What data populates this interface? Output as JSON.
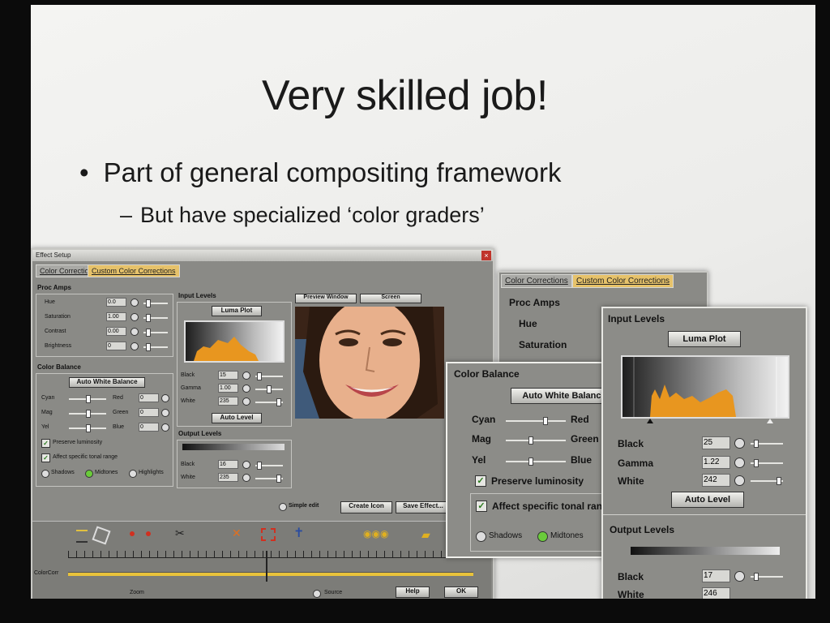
{
  "slide": {
    "title": "Very skilled job!",
    "bullet1": "Part of general compositing framework",
    "bullet2": "But have specialized ‘color graders’"
  },
  "effect_setup": {
    "window_title": "Effect Setup",
    "tabs": [
      "Color Corrections",
      "Custom Color Corrections"
    ],
    "proc_amps": {
      "label": "Proc Amps",
      "rows": [
        {
          "name": "Hue",
          "value": "0.0"
        },
        {
          "name": "Saturation",
          "value": "1.00"
        },
        {
          "name": "Contrast",
          "value": "0.00"
        },
        {
          "name": "Brightness",
          "value": "0"
        }
      ]
    },
    "color_balance": {
      "label": "Color Balance",
      "auto_white_balance": "Auto White Balance",
      "rows": [
        {
          "left": "Cyan",
          "right": "Red",
          "value": "0"
        },
        {
          "left": "Mag",
          "right": "Green",
          "value": "0"
        },
        {
          "left": "Yel",
          "right": "Blue",
          "value": "0"
        }
      ],
      "preserve_luminosity": "Preserve luminosity",
      "affect_tonal": "Affect specific tonal range",
      "tones": [
        "Shadows",
        "Midtones",
        "Highlights"
      ]
    },
    "input_levels": {
      "label": "Input Levels",
      "luma_plot": "Luma Plot",
      "rows": [
        {
          "name": "Black",
          "value": "15"
        },
        {
          "name": "Gamma",
          "value": "1.00"
        },
        {
          "name": "White",
          "value": "235"
        }
      ],
      "auto_level": "Auto Level"
    },
    "output_levels": {
      "label": "Output Levels",
      "rows": [
        {
          "name": "Black",
          "value": "16"
        },
        {
          "name": "White",
          "value": "235"
        }
      ]
    },
    "preview_buttons": [
      "Preview Window",
      "Screen"
    ],
    "simple_edit": "Simple edit",
    "create_icon": "Create Icon",
    "save_effect": "Save Effect...",
    "timeline_label": "ColorCorr",
    "zoom_label": "Zoom",
    "source_label": "Source",
    "help": "Help",
    "ok": "OK"
  },
  "zoom_proc": {
    "tabs": [
      "Color Corrections",
      "Custom Color Corrections"
    ],
    "label": "Proc Amps",
    "rows": [
      "Hue",
      "Saturation"
    ]
  },
  "zoom_balance": {
    "label": "Color Balance",
    "auto_white_balance": "Auto White Balance",
    "rows": [
      {
        "left": "Cyan",
        "right": "Red"
      },
      {
        "left": "Mag",
        "right": "Green"
      },
      {
        "left": "Yel",
        "right": "Blue"
      }
    ],
    "preserve_luminosity": "Preserve luminosity",
    "affect_tonal": "Affect specific tonal range",
    "tones": [
      "Shadows",
      "Midtones"
    ]
  },
  "zoom_levels": {
    "label": "Input Levels",
    "luma_plot": "Luma Plot",
    "rows": [
      {
        "name": "Black",
        "value": "25"
      },
      {
        "name": "Gamma",
        "value": "1.22"
      },
      {
        "name": "White",
        "value": "242"
      }
    ],
    "auto_level": "Auto Level",
    "output_label": "Output Levels",
    "out_rows": [
      {
        "name": "Black",
        "value": "17"
      },
      {
        "name": "White",
        "value": "246"
      }
    ]
  },
  "colors": {
    "accent_tab": "#e6c26a",
    "histogram": "#e8961f",
    "radio_on": "#6acb3a",
    "panel": "#8a8a86"
  }
}
